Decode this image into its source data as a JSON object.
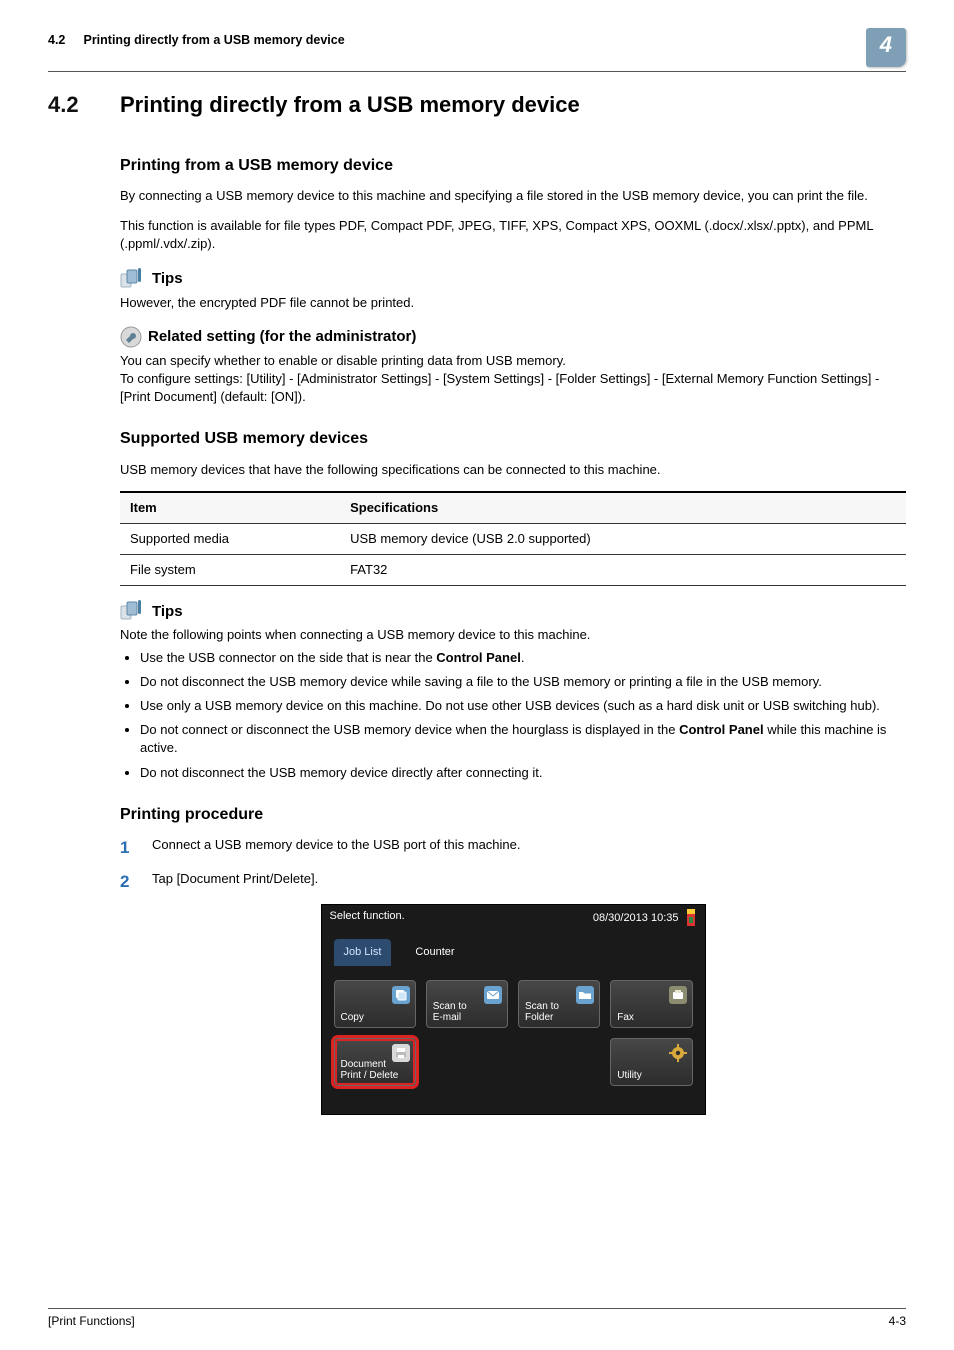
{
  "header": {
    "section_number": "4.2",
    "title": "Printing directly from a USB memory device",
    "chapter_badge": "4"
  },
  "section": {
    "number": "4.2",
    "heading": "Printing directly from a USB memory device"
  },
  "sub1": {
    "heading": "Printing from a USB memory device",
    "p1": "By connecting a USB memory device to this machine and specifying a file stored in the USB memory device, you can print the file.",
    "p2": "This function is available for file types PDF, Compact PDF, JPEG, TIFF, XPS, Compact XPS, OOXML (.docx/.xlsx/.pptx), and PPML (.ppml/.vdx/.zip)."
  },
  "tips1": {
    "label": "Tips",
    "body": "However, the encrypted PDF file cannot be printed."
  },
  "related": {
    "label": "Related setting (for the administrator)",
    "l1": "You can specify whether to enable or disable printing data from USB memory.",
    "l2": "To configure settings: [Utility] - [Administrator Settings] - [System Settings] - [Folder Settings] - [External Memory Function Settings] - [Print Document] (default: [ON])."
  },
  "sub2": {
    "heading": "Supported USB memory devices",
    "intro": "USB memory devices that have the following specifications can be connected to this machine.",
    "table": {
      "h1": "Item",
      "h2": "Specifications",
      "r1c1": "Supported media",
      "r1c2": "USB memory device (USB 2.0 supported)",
      "r2c1": "File system",
      "r2c2": "FAT32"
    }
  },
  "tips2": {
    "label": "Tips",
    "intro": "Note the following points when connecting a USB memory device to this machine.",
    "b1a": "Use the USB connector on the side that is near the ",
    "b1b": "Control Panel",
    "b1c": ".",
    "b2": "Do not disconnect the USB memory device while saving a file to the USB memory or printing a file in the USB memory.",
    "b3": "Use only a USB memory device on this machine. Do not use other USB devices (such as a hard disk unit or USB switching hub).",
    "b4a": "Do not connect or disconnect the USB memory device when the hourglass is displayed in the ",
    "b4b": "Control Panel",
    "b4c": " while this machine is active.",
    "b5": "Do not disconnect the USB memory device directly after connecting it."
  },
  "sub3": {
    "heading": "Printing procedure",
    "s1": "Connect a USB memory device to the USB port of this machine.",
    "s2": "Tap [Document Print/Delete]."
  },
  "screenshot": {
    "top_text": "Select function.",
    "timestamp": "08/30/2013 10:35",
    "tab_job": "Job List",
    "tab_counter": "Counter",
    "copy": "Copy",
    "scan_email": "Scan to\nE-mail",
    "scan_folder": "Scan to\nFolder",
    "fax": "Fax",
    "doc_pd": "Document\nPrint / Delete",
    "utility": "Utility"
  },
  "footer": {
    "left": "[Print Functions]",
    "right": "4-3"
  }
}
